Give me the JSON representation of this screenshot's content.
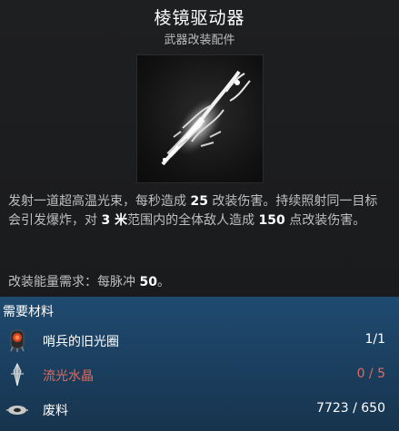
{
  "item": {
    "title": "棱镜驱动器",
    "subtitle": "武器改装配件"
  },
  "description": {
    "part1": "发射一道超高温光束，每秒造成 ",
    "dmg_per_sec": "25",
    "part2": " 改装伤害。持续照射同一目标会引发爆炸，对 ",
    "range": "3 米",
    "part3": "范围内的全体敌人造成 ",
    "explosion_dmg": "150",
    "part4": " 点改装伤害。"
  },
  "energy": {
    "label": "改装能量需求：每脉冲 ",
    "value": "50",
    "suffix": "。"
  },
  "materials": {
    "header": "需要材料",
    "items": [
      {
        "name": "哨兵的旧光圈",
        "count": "1/1",
        "icon": "sentinel-aperture-icon",
        "status": "ok"
      },
      {
        "name": "流光水晶",
        "count": "0 / 5",
        "icon": "crystal-icon",
        "status": "lacking"
      },
      {
        "name": "废料",
        "count": "7723 / 650",
        "icon": "scrap-icon",
        "status": "ok"
      }
    ]
  },
  "colors": {
    "lacking": "#e06a5e",
    "materials_bg": "#1f4a70"
  }
}
